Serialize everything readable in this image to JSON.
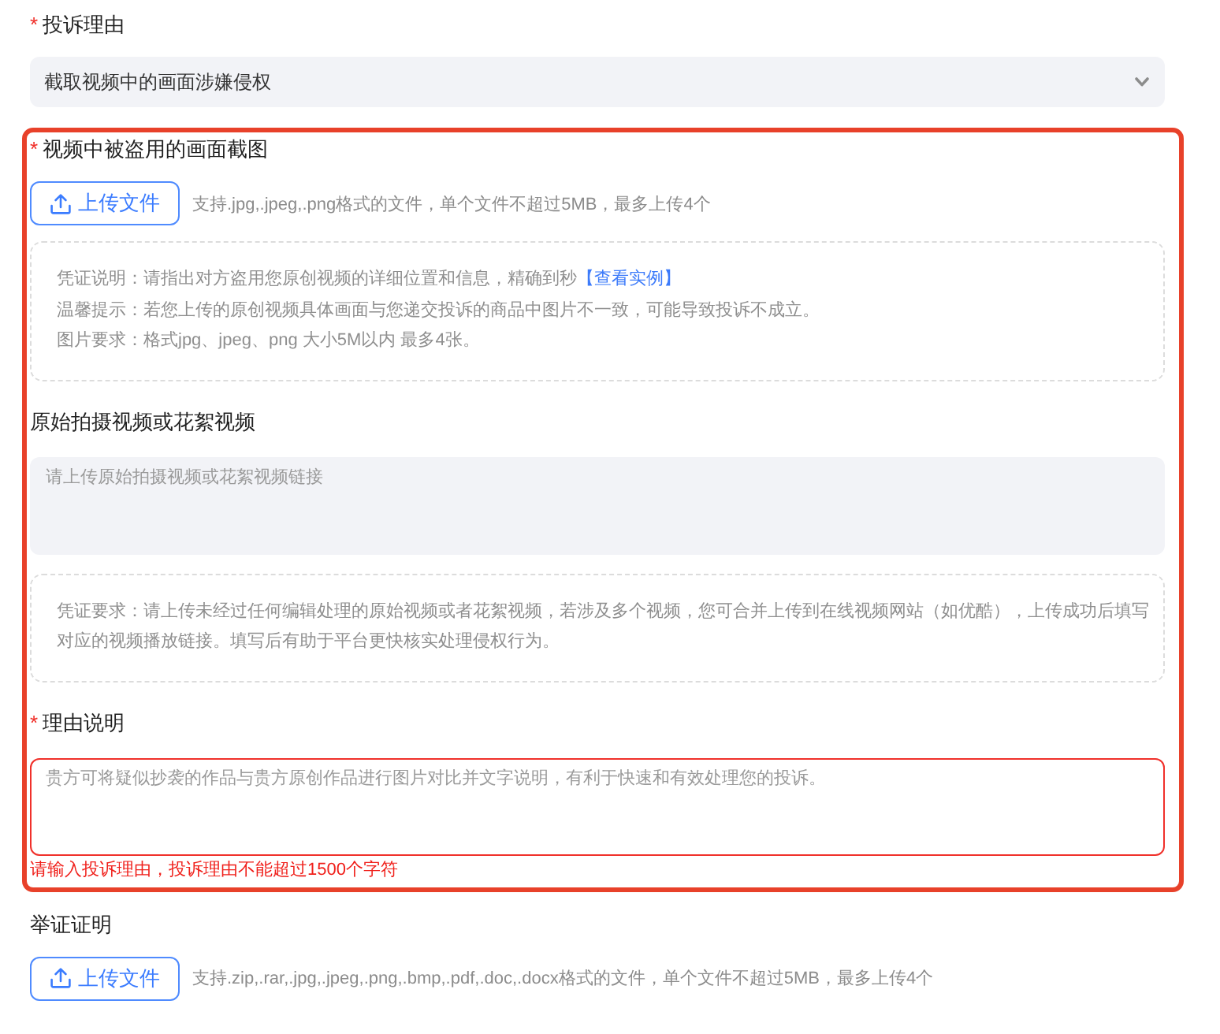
{
  "fields": [
    {
      "kind": "select",
      "mark": "*",
      "label": "投诉理由",
      "value": "截取视频中的画面涉嫌侵权",
      "highlighted": false
    },
    {
      "kind": "upload",
      "mark": "*",
      "label": "视频中被盗用的画面截图",
      "button": "上传文件",
      "hint": "支持.jpg,.jpeg,.png格式的文件，单个文件不超过5MB，最多上传4个",
      "notes": [
        {
          "text": "凭证说明：请指出对方盗用您原创视频的详细位置和信息，精确到秒",
          "link": "【查看实例】"
        },
        {
          "text": "温馨提示：若您上传的原创视频具体画面与您递交投诉的商品中图片不一致，可能导致投诉不成立。"
        },
        {
          "text": "图片要求：格式jpg、jpeg、png 大小5M以内 最多4张。"
        }
      ],
      "highlighted": true
    },
    {
      "kind": "textarea",
      "label": "原始拍摄视频或花絮视频",
      "placeholder": "请上传原始拍摄视频或花絮视频链接",
      "invalid": false,
      "notes": [
        {
          "text": "凭证要求：请上传未经过任何编辑处理的原始视频或者花絮视频，若涉及多个视频，您可合并上传到在线视频网站（如优酷），上传成功后填写对应的视频播放链接。填写后有助于平台更快核实处理侵权行为。"
        }
      ],
      "highlighted": true
    },
    {
      "kind": "textarea",
      "mark": "*",
      "label": "理由说明",
      "placeholder": "贵方可将疑似抄袭的作品与贵方原创作品进行图片对比并文字说明，有利于快速和有效处理您的投诉。",
      "invalid": true,
      "error": "请输入投诉理由，投诉理由不能超过1500个字符",
      "highlighted": true
    },
    {
      "kind": "upload",
      "label": "举证证明",
      "button": "上传文件",
      "hint": "支持.zip,.rar,.jpg,.jpeg,.png,.bmp,.pdf,.doc,.docx格式的文件，单个文件不超过5MB，最多上传4个",
      "highlighted": false
    }
  ]
}
